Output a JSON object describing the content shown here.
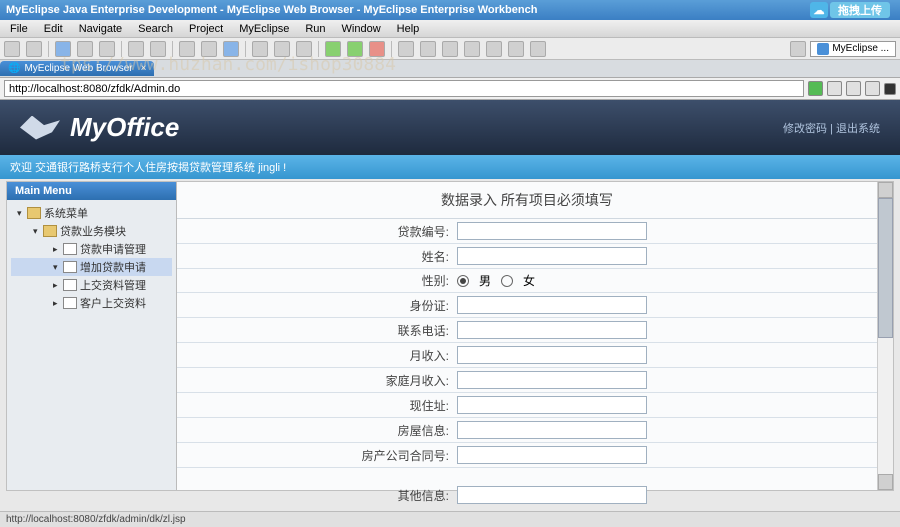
{
  "window": {
    "title": "MyEclipse Java Enterprise Development - MyEclipse Web Browser - MyEclipse Enterprise Workbench",
    "upload_badge": "拖拽上传"
  },
  "menu": {
    "items": [
      "File",
      "Edit",
      "Navigate",
      "Search",
      "Project",
      "MyEclipse",
      "Run",
      "Window",
      "Help"
    ]
  },
  "perspective": "MyEclipse ...",
  "tab": "MyEclipse Web Browser",
  "url": "http://localhost:8080/zfdk/Admin.do",
  "watermark": "tps://www.huzhan.com/ishop30884",
  "app": {
    "logo": "MyOffice",
    "link_pwd": "修改密码",
    "link_exit": "退出系统",
    "welcome": "欢迎 交通银行路桥支行个人住房按揭贷款管理系统 jingli !"
  },
  "sidebar": {
    "title": "Main Menu",
    "root": "系统菜单",
    "module": "贷款业务模块",
    "items": [
      "贷款申请管理",
      "增加贷款申请",
      "上交资料管理",
      "客户上交资料"
    ]
  },
  "form": {
    "title": "数据录入 所有项目必须填写",
    "fields": {
      "loan_no": "贷款编号:",
      "name": "姓名:",
      "gender": "性别:",
      "idcard": "身份证:",
      "phone": "联系电话:",
      "income": "月收入:",
      "family_income": "家庭月收入:",
      "address": "现住址:",
      "house_info": "房屋信息:",
      "contract_no": "房产公司合同号:",
      "other": "其他信息:"
    },
    "gender_male": "男",
    "gender_female": "女"
  },
  "status": "http://localhost:8080/zfdk/admin/dk/zl.jsp"
}
